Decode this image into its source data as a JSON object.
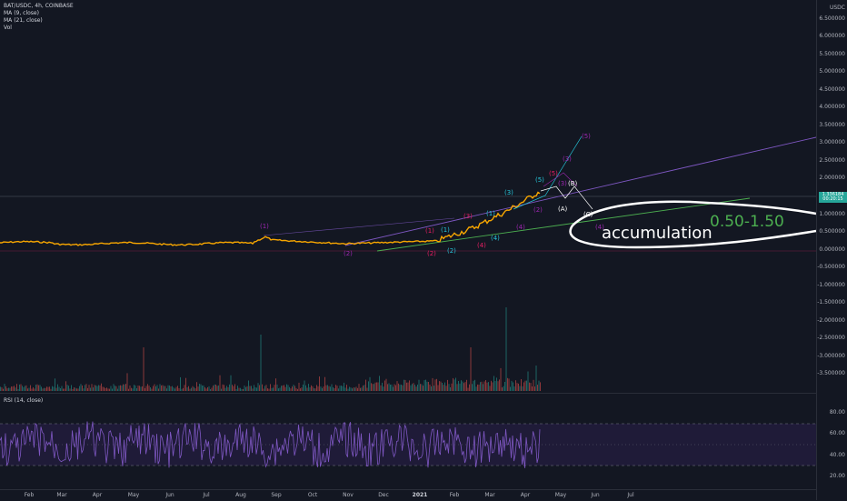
{
  "legend": {
    "symbol_line": "BAT/USDC, 4h, COINBASE",
    "ma9": "MA (9, close)",
    "ma21": "MA (21, close)",
    "vol": "Vol"
  },
  "rsi_legend": "RSI (14, close)",
  "currency": "USDC",
  "price_labels": [
    "6.500000",
    "6.000000",
    "5.500000",
    "5.000000",
    "4.500000",
    "4.000000",
    "3.500000",
    "3.000000",
    "2.500000",
    "2.000000",
    "1.500000",
    "1.000000",
    "0.500000",
    "0.000000",
    "-0.500000",
    "-1.000000",
    "-1.500000",
    "-2.000000",
    "-2.500000",
    "-3.000000",
    "-3.500000"
  ],
  "current_price": "1.336184",
  "countdown": "00:20:15",
  "rsi_labels": [
    "80.00",
    "60.00",
    "40.00",
    "20.00"
  ],
  "time_labels": [
    "Feb",
    "Mar",
    "Apr",
    "May",
    "Jun",
    "Jul",
    "Aug",
    "Sep",
    "Oct",
    "Nov",
    "Dec",
    "2021",
    "Feb",
    "Mar",
    "Apr",
    "May",
    "Jun",
    "Jul"
  ],
  "annotations": {
    "accumulation": "accumulation",
    "range": "0.50-1.50"
  },
  "wave_labels": [
    "(1)",
    "(2)",
    "(1)",
    "(2)",
    "(3)",
    "(4)",
    "(1)",
    "(2)",
    "(3)",
    "(4)",
    "(5)",
    "(1)",
    "(2)",
    "(3)",
    "(4)",
    "(5)",
    "(3)",
    "(4)",
    "(5)",
    "(A)",
    "(B)",
    "(C)"
  ],
  "colors": {
    "background": "#131722",
    "price_line": "#f7a600",
    "wave_purple": "#9c27b0",
    "wave_pink": "#e91e63",
    "wave_teal": "#26c6da",
    "trend_purple": "#7e57c2",
    "trend_green": "#4caf50",
    "rsi": "#7e57c2",
    "accumulation_text": "#ffffff",
    "range_text": "#4caf50"
  }
}
